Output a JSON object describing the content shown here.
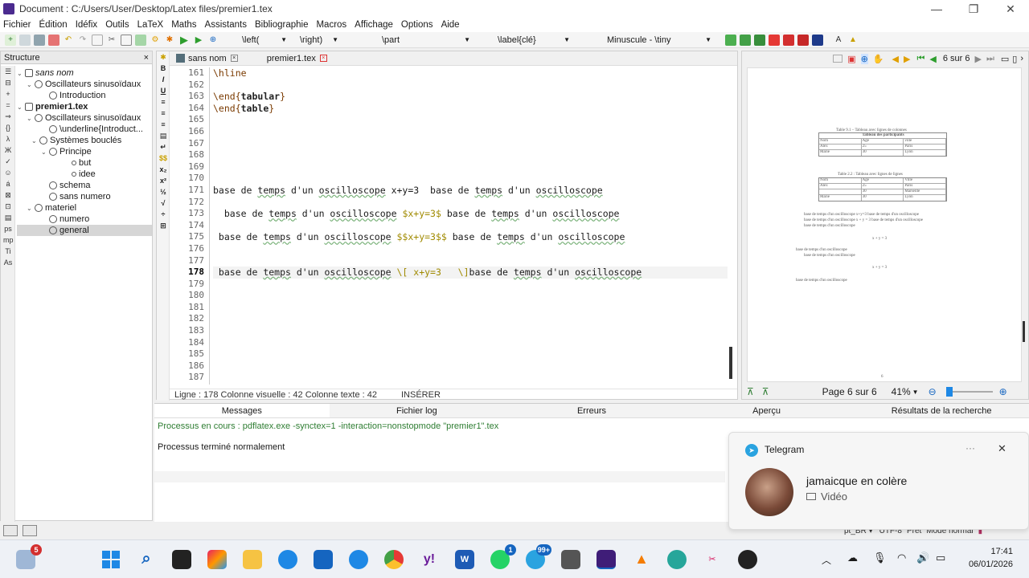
{
  "window": {
    "title": "Document : C:/Users/User/Desktop/Latex files/premier1.tex",
    "controls": [
      "—",
      "❐",
      "✕"
    ]
  },
  "menu": [
    "Fichier",
    "Édition",
    "Idéfix",
    "Outils",
    "Maths",
    "Assistants",
    "Bibliographie",
    "Macros",
    "Affichage",
    "Options",
    "Aide"
  ],
  "toolbar": {
    "combo_left": "\\left(",
    "combo_right": "\\right)",
    "combo_part": "\\part",
    "combo_label": "\\label{clé}",
    "combo_size": "Minuscule - \\tiny"
  },
  "structure": {
    "title": "Structure",
    "close": "×",
    "tree": [
      {
        "label": "sans nom",
        "level": 0,
        "italic": true,
        "tog": "⌄"
      },
      {
        "label": "Oscillateurs sinusoïdaux",
        "level": 1,
        "tog": "⌄"
      },
      {
        "label": "Introduction",
        "level": 2,
        "tog": ""
      },
      {
        "label": "premier1.tex",
        "level": 0,
        "bold": true,
        "tog": "⌄"
      },
      {
        "label": "Oscillateurs sinusoïdaux",
        "level": 1,
        "tog": "⌄"
      },
      {
        "label": "\\underline{Introduct...",
        "level": 2,
        "tog": ""
      },
      {
        "label": "Systèmes bouclés",
        "level": 2,
        "tog": "⌄"
      },
      {
        "label": "Principe",
        "level": 3,
        "tog": "⌄"
      },
      {
        "label": "but",
        "level": 4,
        "tog": ""
      },
      {
        "label": "idee",
        "level": 4,
        "tog": ""
      },
      {
        "label": "schema",
        "level": 1,
        "tog": ""
      },
      {
        "label": "sans numero",
        "level": 1,
        "tog": ""
      },
      {
        "label": "materiel",
        "level": 1,
        "tog": "⌄"
      },
      {
        "label": "numero",
        "level": 2,
        "tog": ""
      },
      {
        "label": "general",
        "level": 2,
        "tog": "",
        "selected": true
      }
    ]
  },
  "tabs": [
    {
      "label": "sans nom",
      "active": false
    },
    {
      "label": "premier1.tex",
      "active": true
    }
  ],
  "editor": {
    "line_numbers": [
      "161",
      "162",
      "163",
      "164",
      "165",
      "166",
      "167",
      "168",
      "169",
      "170",
      "171",
      "172",
      "173",
      "174",
      "175",
      "176",
      "177",
      "178",
      "179",
      "180",
      "181",
      "182",
      "183",
      "184",
      "185",
      "186",
      "187"
    ],
    "current_line": "178",
    "status": {
      "line": "Ligne : 178",
      "col_visual": "Colonne visuelle : 42",
      "col_text": "Colonne texte : 42",
      "mode": "INSÉRER"
    },
    "lines": {
      "l161": "\\hline",
      "l163_a": "\\end{",
      "l163_b": "tabular",
      "l163_c": "}",
      "l164_a": "\\end{",
      "l164_b": "table",
      "l164_c": "}",
      "l171_a": "base de ",
      "l171_b": "temps",
      "l171_c": " d'un ",
      "l171_d": "oscilloscope",
      "l171_e": " x+y=3  base de ",
      "l171_f": "temps",
      "l171_g": " d'un ",
      "l171_h": "oscilloscope",
      "l173_a": "  base de ",
      "l173_b": "temps",
      "l173_c": " d'un ",
      "l173_d": "oscilloscope",
      "l173_e": " $x+y=3$",
      "l173_f": " base de ",
      "l173_g": "temps",
      "l173_h": " d'un ",
      "l173_i": "oscilloscope",
      "l175_a": " base de ",
      "l175_b": "temps",
      "l175_c": " d'un ",
      "l175_d": "oscilloscope",
      "l175_e": " $$x+y=3$$",
      "l175_f": " base de ",
      "l175_g": "temps",
      "l175_h": " d'un ",
      "l175_i": "oscilloscope",
      "l178_a": " base de ",
      "l178_b": "temps",
      "l178_c": " d'un ",
      "l178_d": "oscilloscope",
      "l178_e": " \\[ x+y=3   \\]",
      "l178_f": "base de ",
      "l178_g": "temps",
      "l178_h": " d'un ",
      "l178_i": "oscilloscope"
    }
  },
  "preview": {
    "page_indicator": "6 sur 6",
    "page_status": "Page 6 sur 6",
    "zoom": "41%",
    "table1_caption": "Table 9.1 – Tableau avec lignes de colonnes",
    "table1_title": "Tableau des participants",
    "table1_rows": [
      [
        "Nom",
        "Age",
        "ville"
      ],
      [
        "Alex",
        "25",
        "Paris"
      ],
      [
        "Marie",
        "30",
        "Lyon"
      ]
    ],
    "table2_caption": "Table 2.2 : Tableau avec lignes de lignes",
    "table2_rows": [
      [
        "Nom",
        "Age",
        "Ville"
      ],
      [
        "Alex",
        "25",
        "Paris"
      ],
      [
        "",
        "30",
        "Marseille"
      ],
      [
        "Marie",
        "30",
        "Lyon"
      ]
    ],
    "text_lines": [
      "base de temps d'un oscilloscope x+y=3 base de temps d'un oscilloscope",
      "base de temps d'un oscilloscope x + y = 3 base de temps d'un oscilloscope",
      "base de temps d'un oscilloscope",
      "x + y = 3",
      "base de temps d'un oscilloscope",
      "base de temps d'un oscilloscope",
      "x + y = 3",
      "base de temps d'un oscilloscope"
    ],
    "page_number": "6"
  },
  "bottom": {
    "tabs": [
      "Messages",
      "Fichier log",
      "Erreurs",
      "Aperçu",
      "Résultats de la recherche"
    ],
    "messages": [
      "Processus en cours : pdflatex.exe  -synctex=1 -interaction=nonstopmode \"premier1\".tex",
      "Processus terminé normalement"
    ]
  },
  "notification": {
    "app": "Telegram",
    "more": "···",
    "close": "✕",
    "sender": "jamaicque en colère",
    "body": "Vidéo"
  },
  "statusbar": {
    "lang": "pt_BR ▾",
    "encoding": "UTF-8",
    "ready": "Prêt",
    "mode": "Mode normal"
  },
  "taskbar": {
    "weather_badge": "5",
    "whatsapp_badge": "1",
    "telegram_badge": "99+",
    "time": "17:41",
    "date": "06/01/2026"
  },
  "colors": {
    "keyword": "#7a3a00",
    "math": "#a08a00",
    "accent": "#1565c0"
  }
}
